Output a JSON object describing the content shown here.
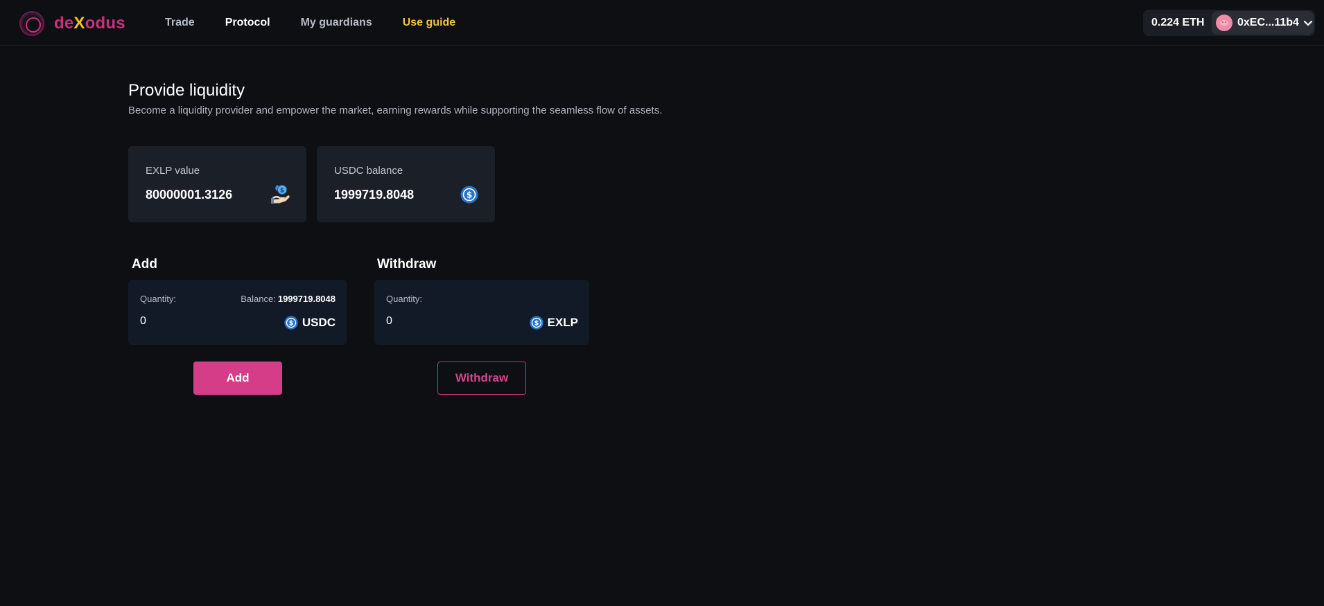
{
  "header": {
    "logo": {
      "part1": "de",
      "part2": "X",
      "part3": "odus"
    },
    "nav": [
      {
        "label": "Trade"
      },
      {
        "label": "Protocol"
      },
      {
        "label": "My guardians"
      },
      {
        "label": "Use guide"
      }
    ],
    "eth_balance": "0.224 ETH",
    "wallet_address": "0xEC...11b4"
  },
  "page": {
    "title": "Provide liquidity",
    "subtitle": "Become a liquidity provider and empower the market, earning rewards while supporting the seamless flow of assets."
  },
  "stats": {
    "exlp": {
      "label": "EXLP value",
      "value": "80000001.3126",
      "icon": "hand-coin-icon"
    },
    "usdc": {
      "label": "USDC balance",
      "value": "1999719.8048",
      "icon": "usdc-icon"
    }
  },
  "add": {
    "title": "Add",
    "quantity_label": "Quantity:",
    "balance_label": "Balance:",
    "balance_value": "1999719.8048",
    "input_value": "0",
    "token": "USDC",
    "button_label": "Add"
  },
  "withdraw": {
    "title": "Withdraw",
    "quantity_label": "Quantity:",
    "input_value": "0",
    "token": "EXLP",
    "button_label": "Withdraw"
  },
  "colors": {
    "background": "#0d0f13",
    "card": "#1b1f27",
    "input_box": "#131a27",
    "accent_pink": "#d63d89",
    "guide_yellow": "#f3c33c",
    "usdc_blue": "#2775ca"
  }
}
